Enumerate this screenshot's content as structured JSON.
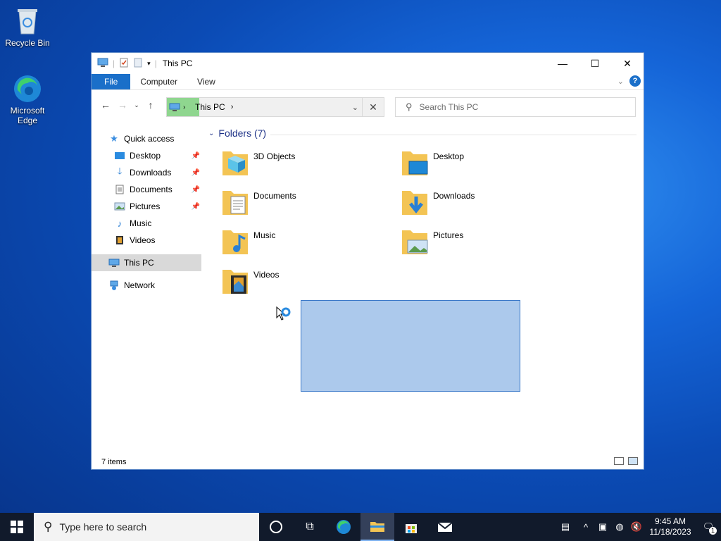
{
  "desktop": {
    "icons": [
      {
        "label": "Recycle Bin",
        "icon": "recycle-bin-icon"
      },
      {
        "label": "Microsoft Edge",
        "icon": "edge-icon"
      }
    ]
  },
  "window": {
    "title": "This PC",
    "ribbon_tabs": [
      "File",
      "Computer",
      "View"
    ],
    "address": {
      "path": "This PC",
      "separator": "›"
    },
    "search": {
      "placeholder": "Search This PC"
    },
    "nav_pane": {
      "quick_access": "Quick access",
      "items": [
        {
          "label": "Desktop",
          "pinned": true
        },
        {
          "label": "Downloads",
          "pinned": true
        },
        {
          "label": "Documents",
          "pinned": true
        },
        {
          "label": "Pictures",
          "pinned": true
        },
        {
          "label": "Music",
          "pinned": false
        },
        {
          "label": "Videos",
          "pinned": false
        }
      ],
      "this_pc": "This PC",
      "network": "Network"
    },
    "group_header": "Folders (7)",
    "folders": [
      {
        "label": "3D Objects",
        "icon": "3d-objects-folder-icon"
      },
      {
        "label": "Desktop",
        "icon": "desktop-folder-icon"
      },
      {
        "label": "Documents",
        "icon": "documents-folder-icon"
      },
      {
        "label": "Downloads",
        "icon": "downloads-folder-icon"
      },
      {
        "label": "Music",
        "icon": "music-folder-icon"
      },
      {
        "label": "Pictures",
        "icon": "pictures-folder-icon"
      },
      {
        "label": "Videos",
        "icon": "videos-folder-icon"
      }
    ],
    "status": "7 items"
  },
  "taskbar": {
    "search_placeholder": "Type here to search",
    "clock_time": "9:45 AM",
    "clock_date": "11/18/2023",
    "notification_count": "1"
  },
  "colors": {
    "accent": "#1a6fc9",
    "selection": "#acc9ec",
    "taskbar": "#111a2b"
  }
}
